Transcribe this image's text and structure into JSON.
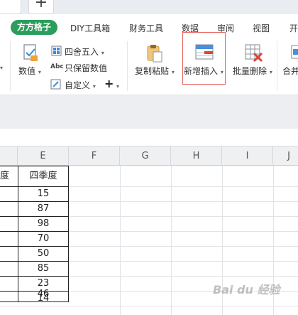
{
  "tabs": {
    "new_tab_glyph": "+"
  },
  "menu": {
    "brand": "方方格子",
    "items": [
      "DIY工具箱",
      "财务工具",
      "数据",
      "审阅",
      "视图",
      "开"
    ]
  },
  "ribbon": {
    "numeric": {
      "label": "数值",
      "icon": "number-format-icon"
    },
    "round": {
      "label": "四舍五入",
      "icon": "round-icon"
    },
    "keep_numbers": {
      "label": "只保留数值",
      "icon": "abc-icon",
      "glyph": "Abc"
    },
    "custom": {
      "label": "自定义",
      "icon": "custom-icon"
    },
    "add_glyph": "+",
    "copy_paste": {
      "label": "复制粘贴",
      "icon": "clipboard-icon"
    },
    "new_insert": {
      "label": "新增插入",
      "icon": "insert-row-icon"
    },
    "batch_delete": {
      "label": "批量删除",
      "icon": "delete-table-icon"
    },
    "merge": {
      "label": "合并",
      "icon": "merge-icon"
    }
  },
  "grid": {
    "columns": [
      "E",
      "F",
      "G",
      "H",
      "I",
      "J"
    ],
    "partial_header": "度",
    "header_e": "四季度",
    "values": [
      "15",
      "87",
      "98",
      "70",
      "50",
      "85",
      "23",
      "46",
      "14"
    ]
  },
  "watermark": "Bai du 经验",
  "colors": {
    "brand_green": "#2b9d5c",
    "highlight_red": "#e7635e",
    "tab_dot": "#f29a3e"
  }
}
